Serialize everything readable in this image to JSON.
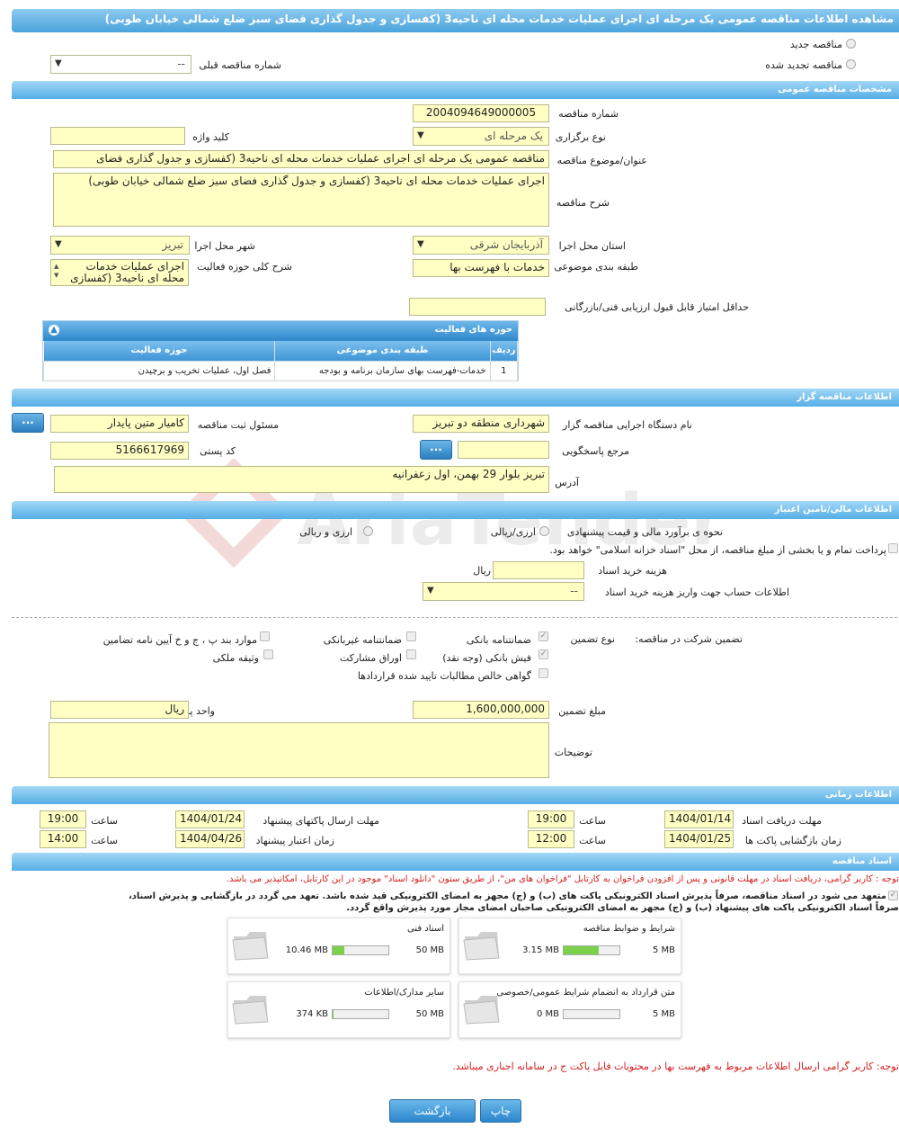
{
  "title": "مشاهده اطلاعات مناقصه عمومی یک مرحله ای اجرای عملیات خدمات محله ای ناحیه3 (کفسازی و جدول گذاری فضای سبز ضلع شمالی خیابان طوبی)",
  "top": {
    "radio_new": "مناقصه جدید",
    "radio_renew": "مناقصه تجدید شده",
    "prev_number_label": "شماره مناقصه قبلی",
    "prev_number_value": "--"
  },
  "general": {
    "section": "مشخصات مناقصه عمومی",
    "number_label": "شماره مناقصه",
    "number_value": "2004094649000005",
    "type_label": "نوع برگزاری",
    "type_value": "یک مرحله ای",
    "keyword_label": "کلید واژه",
    "keyword_value": "",
    "subject_label": "عنوان/موضوع مناقصه",
    "subject_value": "مناقصه عمومی یک مرحله ای اجرای عملیات خدمات محله ای ناحیه3 (کفسازی و جدول گذاری فضای",
    "desc_label": "شرح مناقصه",
    "desc_value": "اجرای عملیات خدمات محله ای ناحیه3 (کفسازی و جدول گذاری فضای سبز ضلع شمالی        خیابان طوبی)",
    "province_label": "استان محل اجرا",
    "province_value": "آذربایجان شرقی",
    "city_label": "شهر محل اجرا",
    "city_value": "تبریز",
    "category_label": "طبقه بندی موضوعی",
    "category_value": "خدمات با فهرست بها",
    "activity_label": "شرح کلی حوزه فعالیت",
    "activity_value": "اجرای عملیات خدمات محله ای ناحیه3 (کفسازی",
    "minscore_label": "حداقل امتیاز قابل قبول ارزیابی فنی/بازرگانی",
    "minscore_value": ""
  },
  "activities": {
    "title": "حوزه های فعالیت",
    "headers": [
      "ردیف",
      "طبقه بندی موضوعی",
      "حوزه فعالیت"
    ],
    "rows": [
      [
        "1",
        "خدمات-فهرست بهای سازمان برنامه و بودجه",
        "فصل اول، عملیات تخریب و برچیدن"
      ]
    ]
  },
  "organizer": {
    "section": "اطلاعات مناقصه گزار",
    "org_label": "نام دستگاه اجرایی مناقصه گزار",
    "org_value": "شهرداری منطقه دو تبریز",
    "registrar_label": "مسئول ثبت مناقصه",
    "registrar_value": "کامیار متین  پایدار",
    "ref_label": "مرجع پاسخگویی",
    "ref_value": "",
    "postal_label": "کد پستی",
    "postal_value": "5166617969",
    "address_label": "آدرس",
    "address_value": "تبریز بلوار 29 بهمن، اول زعفرانیه",
    "dots": "..."
  },
  "finance": {
    "section": "اطلاعات مالی/تامین اعتبار",
    "estimate_label": "نحوه ی برآورد مالی و قیمت پیشنهادی",
    "opt_rial": "ارزی/ریالی",
    "opt_currency": "ارزی و ریالی",
    "treasury_text": "پرداخت تمام و یا بخشی از مبلغ مناقصه، از محل \"اسناد خزانه اسلامی\" خواهد بود.",
    "doc_cost_label": "هزینه خرید اسناد",
    "doc_cost_unit": "ریال",
    "doc_cost_value": "",
    "account_label": "اطلاعات حساب جهت واریز هزینه خرید اسناد",
    "account_value": "--"
  },
  "guarantee": {
    "label": "تضمین شرکت در مناقصه:",
    "type_label": "نوع تضمین",
    "options": {
      "bank": "ضمانتنامه بانکی",
      "nonbank": "ضمانتنامه غیربانکی",
      "items": "موارد بند پ ، ج و خ آیین نامه تضامین",
      "cash": "فیش بانکی (وجه نقد)",
      "bonds": "اوراق مشارکت",
      "property": "وثیقه ملکی",
      "claims": "گواهی خالص مطالبات تایید شده قراردادها"
    },
    "amount_label": "مبلغ تضمین",
    "amount_value": "1,600,000,000",
    "unit_label": "واحد پول",
    "unit_value": "ریال",
    "notes_label": "توضیحات",
    "notes_value": ""
  },
  "timing": {
    "section": "اطلاعات زمانی",
    "receive_label": "مهلت دریافت اسناد",
    "receive_date": "1404/01/14",
    "receive_time": "19:00",
    "send_label": "مهلت ارسال پاکتهای پیشنهاد",
    "send_date": "1404/01/24",
    "send_time": "19:00",
    "open_label": "زمان بازگشایی پاکت ها",
    "open_date": "1404/01/25",
    "open_time": "12:00",
    "valid_label": "زمان اعتبار پیشنهاد",
    "valid_date": "1404/04/26",
    "valid_time": "14:00",
    "time_word": "ساعت"
  },
  "docs": {
    "section": "اسناد مناقصه",
    "note1": "توجه : کاربر گرامی، دریافت اسناد در مهلت قانونی و پس از افزودن فراخوان به کارتابل \"فراخوان های من\"، از طریق ستون \"دانلود اسناد\" موجود در این کارتابل، امکانپذیر می باشد.",
    "commit1": "متعهد می شود در اسناد مناقصه، صرفاً پذیرش اسناد الکترونیکی پاکت های (ب) و (ج) مجهز به امضای الکترونیکی قید شده باشد. تعهد می گردد در بازگشایی و پذیرش اسناد،",
    "commit2": "صرفاً اسناد الکترونیکی پاکت های پیشنهاد (ب) و (ج) مجهز به امضای الکترونیکی صاحبان امضای مجاز مورد پذیرش واقع گردد.",
    "files": [
      {
        "name": "شرایط و ضوابط مناقصه",
        "used": "3.15 MB",
        "max": "5 MB",
        "fill": 0.63
      },
      {
        "name": "اسناد فنی",
        "used": "10.46 MB",
        "max": "50 MB",
        "fill": 0.21
      },
      {
        "name": "متن قرارداد به انضمام شرایط عمومی/خصوصی",
        "used": "0 MB",
        "max": "5 MB",
        "fill": 0
      },
      {
        "name": "سایر مدارک/اطلاعات",
        "used": "374 KB",
        "max": "50 MB",
        "fill": 0.01
      }
    ],
    "note2": "توجه: کاربر گرامی ارسال اطلاعات مربوط به فهرست بها در محتویات فایل پاکت ج در سامانه اجباری میباشد."
  },
  "buttons": {
    "print": "چاپ",
    "back": "بازگشت"
  },
  "watermark": "AriaTender.neT",
  "colors": {
    "header": "#4aa3dd",
    "field": "#ffffc4",
    "red_text": "#d62020",
    "progress": "#7cd14b"
  }
}
